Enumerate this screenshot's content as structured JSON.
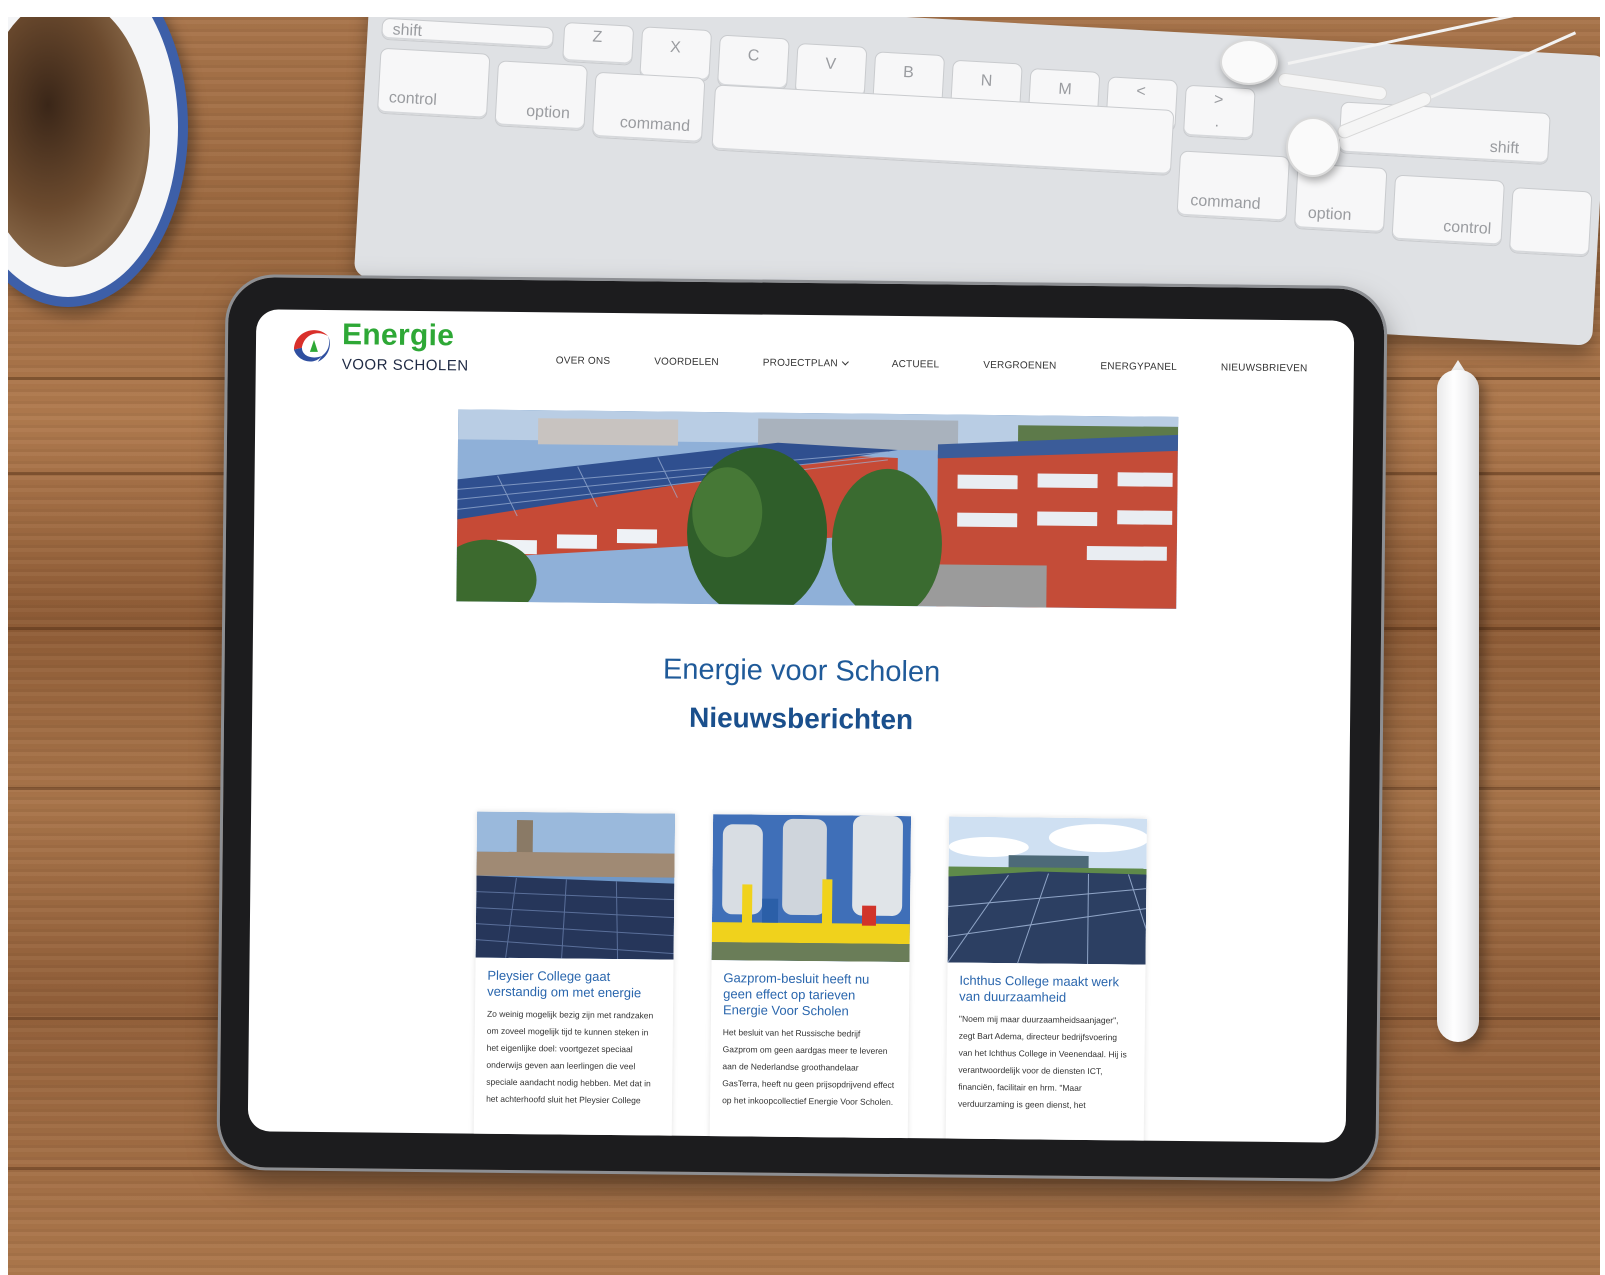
{
  "keyboard": {
    "keys": [
      "shift",
      "Z",
      "X",
      "C",
      "V",
      "B",
      "N",
      "M",
      "<",
      ",",
      ">",
      ".",
      "shift",
      "control",
      "option",
      "command",
      "command",
      "option",
      "control"
    ]
  },
  "site": {
    "logo": {
      "word": "Energie",
      "sub": "VOOR SCHOLEN"
    },
    "nav": [
      {
        "label": "OVER ONS",
        "dropdown": false
      },
      {
        "label": "VOORDELEN",
        "dropdown": false
      },
      {
        "label": "PROJECTPLAN",
        "dropdown": true
      },
      {
        "label": "ACTUEEL",
        "dropdown": false
      },
      {
        "label": "VERGROENEN",
        "dropdown": false
      },
      {
        "label": "ENERGYPANEL",
        "dropdown": false
      },
      {
        "label": "NIEUWSBRIEVEN",
        "dropdown": false
      }
    ],
    "title": "Energie voor Scholen",
    "subtitle": "Nieuwsberichten",
    "articles": [
      {
        "title": "Pleysier College gaat verstandig om met energie",
        "excerpt": "Zo weinig mogelijk bezig zijn met randzaken om zoveel mogelijk tijd te kunnen steken in het eigenlijke doel: voortgezet speciaal onderwijs geven aan leerlingen die veel speciale aandacht nodig hebben. Met dat in het achterhoofd sluit het Pleysier College"
      },
      {
        "title": "Gazprom-besluit heeft nu geen effect op tarieven Energie Voor Scholen",
        "excerpt": "Het besluit van het Russische bedrijf Gazprom om geen aardgas meer te leveren aan de Nederlandse groothandelaar GasTerra, heeft nu geen prijsopdrijvend effect op het inkoopcollectief Energie Voor Scholen."
      },
      {
        "title": "Ichthus College maakt werk van duurzaamheid",
        "excerpt": "\"Noem mij maar duurzaamheidsaanjager\", zegt Bart Adema, directeur bedrijfsvoering van het Ichthus College in Veenendaal. Hij is verantwoordelijk voor de diensten ICT, financiën, facilitair en hrm. \"Maar verduurzaming is geen dienst, het"
      }
    ],
    "colors": {
      "logo_green": "#2ea836",
      "heading_blue": "#1a4f8c",
      "link_blue": "#2a66ad"
    }
  }
}
